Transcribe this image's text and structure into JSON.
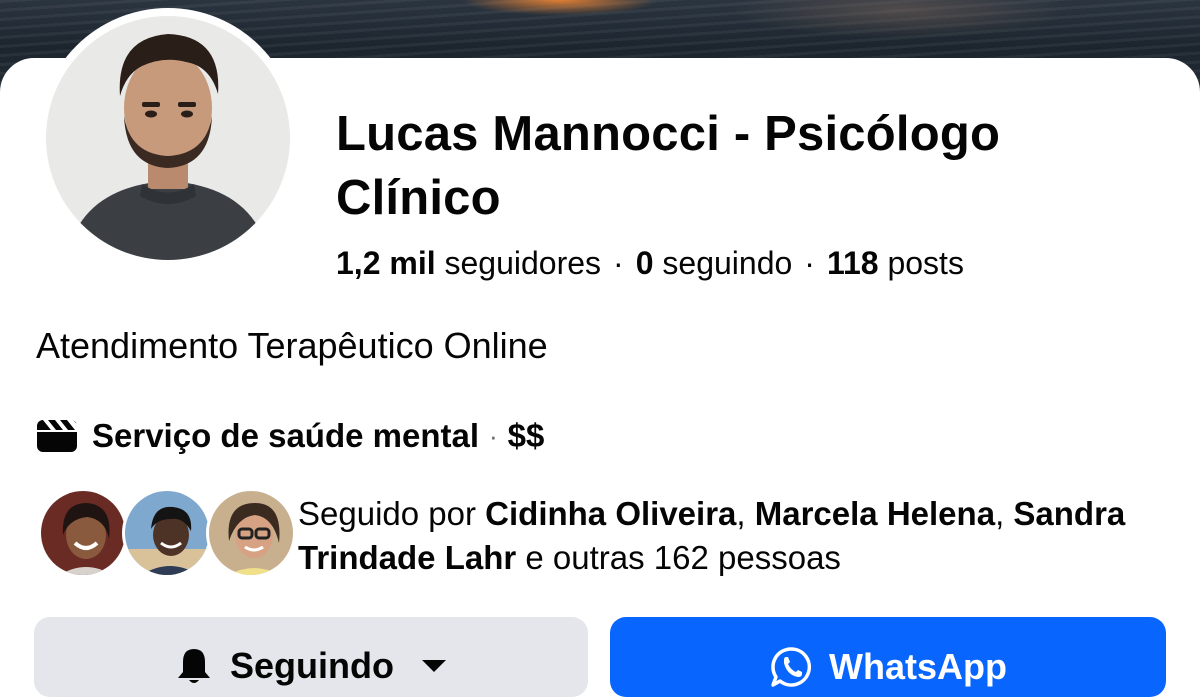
{
  "profile": {
    "name": "Lucas Mannocci - Psicólogo Clínico",
    "stats": {
      "followers_value": "1,2 mil",
      "followers_label": "seguidores",
      "following_value": "0",
      "following_label": "seguindo",
      "posts_value": "118",
      "posts_label": "posts",
      "separator": "·"
    },
    "bio": "Atendimento Terapêutico Online",
    "category": {
      "icon": "clapperboard-icon",
      "label": "Serviço de saúde mental",
      "separator": "·",
      "price": "$$"
    },
    "followed_by": {
      "prefix": "Seguido por",
      "names": [
        "Cidinha Oliveira",
        "Marcela Helena",
        "Sandra Trindade Lahr"
      ],
      "comma": ",",
      "suffix": "e outras 162 pessoas"
    }
  },
  "actions": {
    "following_label": "Seguindo",
    "whatsapp_label": "WhatsApp"
  },
  "colors": {
    "accent": "#0866ff",
    "secondary_button": "#e4e6eb",
    "text": "#050505",
    "muted": "#65676b"
  }
}
